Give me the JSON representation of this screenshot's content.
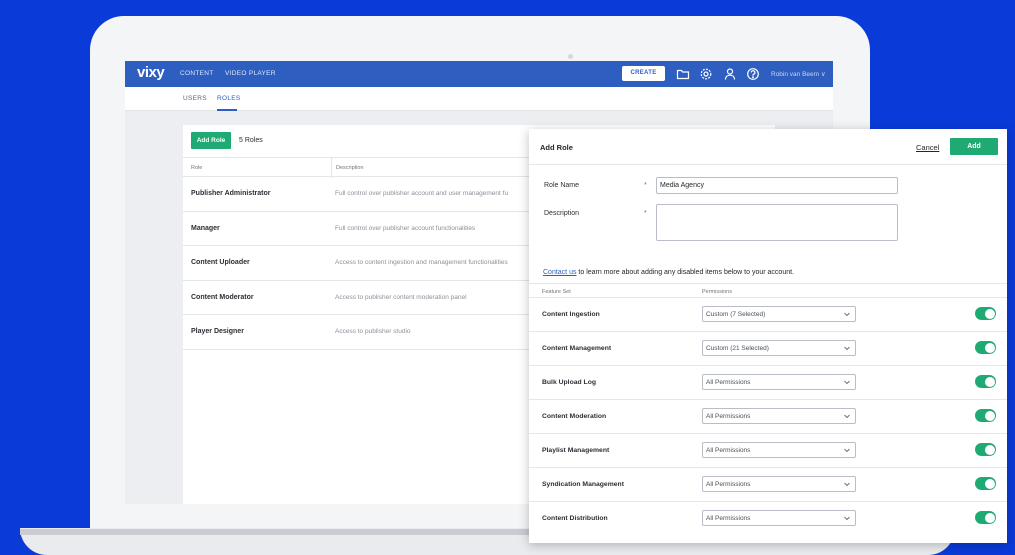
{
  "app": {
    "logo": "vixy",
    "nav": [
      "CONTENT",
      "VIDEO PLAYER"
    ],
    "create_label": "CREATE",
    "user_name": "Robin van Beem ∨",
    "subtabs": [
      "USERS",
      "ROLES"
    ],
    "active_subtab": "ROLES"
  },
  "roles_page": {
    "add_role_label": "Add Role",
    "roles_count": "5 Roles",
    "columns": [
      "Role",
      "Description"
    ],
    "rows": [
      {
        "name": "Publisher Administrator",
        "description": "Full control over publisher account and user management fu"
      },
      {
        "name": "Manager",
        "description": "Full control over publisher account functionalities"
      },
      {
        "name": "Content Uploader",
        "description": "Access to content ingestion and management functionalities"
      },
      {
        "name": "Content Moderator",
        "description": "Access to publisher content moderation panel"
      },
      {
        "name": "Player Designer",
        "description": "Access to publisher studio"
      }
    ]
  },
  "modal": {
    "title": "Add Role",
    "cancel_label": "Cancel",
    "add_label": "Add",
    "role_name_label": "Role Name",
    "role_name_value": "Media Agency",
    "description_label": "Description",
    "required_mark": "*",
    "contact_link": "Contact us",
    "contact_text": " to learn more about adding any disabled items below to your account.",
    "columns": [
      "Feature Set",
      "Permissions"
    ],
    "features": [
      {
        "name": "Content Ingestion",
        "permission": "Custom (7 Selected)",
        "enabled": true
      },
      {
        "name": "Content Management",
        "permission": "Custom (21 Selected)",
        "enabled": true
      },
      {
        "name": "Bulk Upload Log",
        "permission": "All Permissions",
        "enabled": true
      },
      {
        "name": "Content Moderation",
        "permission": "All Permissions",
        "enabled": true
      },
      {
        "name": "Playlist Management",
        "permission": "All Permissions",
        "enabled": true
      },
      {
        "name": "Syndication Management",
        "permission": "All Permissions",
        "enabled": true
      },
      {
        "name": "Content Distribution",
        "permission": "All Permissions",
        "enabled": true
      }
    ]
  },
  "colors": {
    "background": "#0a3bd9",
    "brand_blue": "#2e5fc0",
    "accent_green": "#1faa74"
  }
}
